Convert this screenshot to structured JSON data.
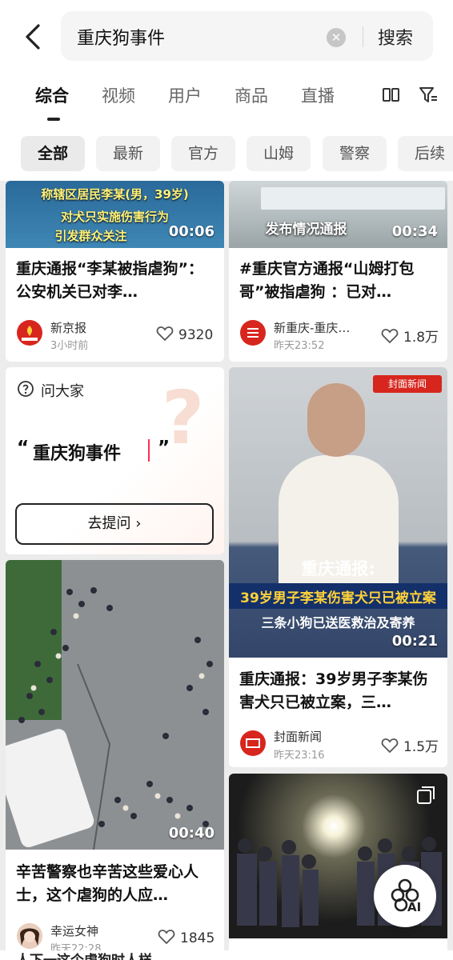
{
  "search": {
    "query": "重庆狗事件",
    "submit_label": "搜索"
  },
  "tabs": [
    "综合",
    "视频",
    "用户",
    "商品",
    "直播"
  ],
  "chips": [
    "全部",
    "最新",
    "官方",
    "山姆",
    "警察",
    "后续"
  ],
  "cards": [
    {
      "overlay": [
        "称辖区居民李某(男，39岁)",
        "对犬只实施伤害行为",
        "引发群众关注"
      ],
      "duration": "00:06",
      "title": "重庆通报“李某被指虐狗”：公安机关已对李…",
      "author": "新京报",
      "time": "3小时前",
      "likes": "9320"
    },
    {
      "overlay": [
        "发布情况通报"
      ],
      "duration": "00:34",
      "title": "#重庆官方通报“山姆打包哥”被指虐狗 ：已对…",
      "author": "新重庆-重庆…",
      "time": "昨天23:52",
      "likes": "1.8万"
    },
    {
      "overlay": [
        "重庆通报:",
        "39岁男子李某伤害犬只已被立案",
        "三条小狗已送医救治及寄养"
      ],
      "duration": "00:21",
      "title": "重庆通报：39岁男子李某伤害犬只已被立案，三…",
      "author": "封面新闻",
      "time": "昨天23:16",
      "likes": "1.5万",
      "watermark": "封面新闻"
    },
    {
      "duration": "00:40",
      "title": "辛苦警察也辛苦这些爱心人士，这个虐狗的人应…",
      "author": "幸运女神",
      "time": "昨天22:28",
      "likes": "1845"
    }
  ],
  "ask": {
    "label": "问大家",
    "quote_open": "“",
    "query": "重庆狗事件",
    "quote_close": "”",
    "button": "去提问 ›"
  },
  "ai_fab_label": "AI",
  "bottom_partial_text": "人下一这个虐狗时人样…",
  "colors": {
    "accent": "#ff2d55",
    "news_red": "#d7261e"
  }
}
